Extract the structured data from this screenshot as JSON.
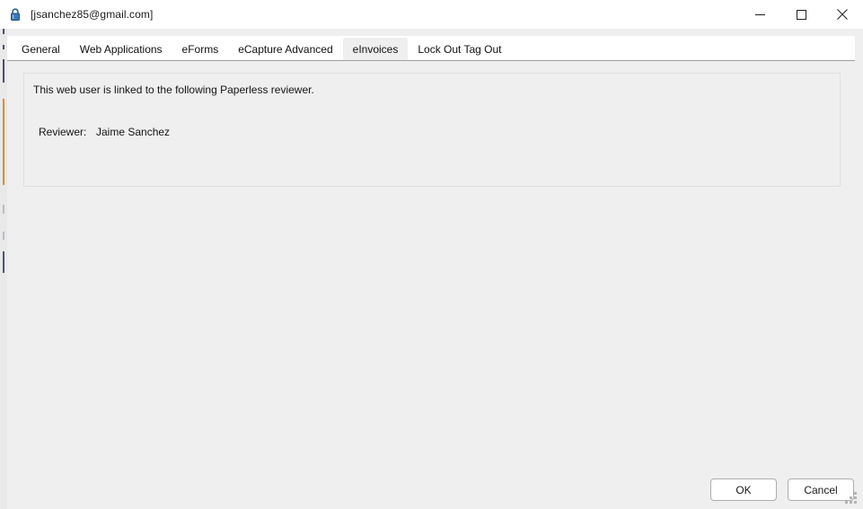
{
  "window": {
    "title": "[jsanchez85@gmail.com]",
    "icon": "lock-icon",
    "accent_colors": {
      "lock_blue": "#2a5d96",
      "strip_orange": "#e08b36",
      "strip_slate": "#4a4f72",
      "body_gray": "#efefef",
      "panel_border": "#dedede",
      "tabstrip_border": "#a0a0a0"
    },
    "controls": {
      "minimize": "minimize-icon",
      "maximize": "maximize-icon",
      "close": "close-icon"
    }
  },
  "tabs": [
    {
      "label": "General",
      "selected": false
    },
    {
      "label": "Web Applications",
      "selected": false
    },
    {
      "label": "eForms",
      "selected": false
    },
    {
      "label": "eCapture Advanced",
      "selected": false
    },
    {
      "label": "eInvoices",
      "selected": true
    },
    {
      "label": "Lock Out Tag Out",
      "selected": false
    }
  ],
  "panel": {
    "intro": "This web user is linked to the following Paperless reviewer.",
    "reviewer_label": "Reviewer:",
    "reviewer_value": "Jaime  Sanchez"
  },
  "footer": {
    "ok_label": "OK",
    "cancel_label": "Cancel"
  }
}
